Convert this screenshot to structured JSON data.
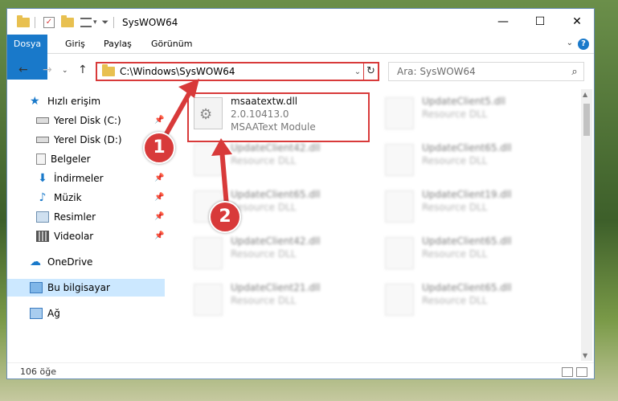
{
  "window": {
    "title": "SysWOW64",
    "controls": [
      "—",
      "☐",
      "✕"
    ]
  },
  "ribbon": {
    "tabs": [
      "Dosya",
      "Giriş",
      "Paylaş",
      "Görünüm"
    ],
    "help": "?"
  },
  "address": {
    "path": "C:\\Windows\\SysWOW64",
    "search_placeholder": "Ara: SysWOW64"
  },
  "nav": {
    "items": [
      {
        "label": "Hızlı erişim",
        "icon": "star-icon",
        "pinned": false
      },
      {
        "label": "Yerel Disk (C:)",
        "icon": "drive-icon",
        "pinned": true
      },
      {
        "label": "Yerel Disk (D:)",
        "icon": "drive-icon",
        "pinned": true
      },
      {
        "label": "Belgeler",
        "icon": "documents-icon",
        "pinned": true
      },
      {
        "label": "İndirmeler",
        "icon": "download-icon",
        "pinned": true
      },
      {
        "label": "Müzik",
        "icon": "music-icon",
        "pinned": true
      },
      {
        "label": "Resimler",
        "icon": "pictures-icon",
        "pinned": true
      },
      {
        "label": "Videolar",
        "icon": "videos-icon",
        "pinned": true
      },
      {
        "label": "OneDrive",
        "icon": "cloud-icon",
        "pinned": false
      },
      {
        "label": "Bu bilgisayar",
        "icon": "computer-icon",
        "pinned": false,
        "selected": true
      },
      {
        "label": "Ağ",
        "icon": "network-icon",
        "pinned": false
      }
    ]
  },
  "files": [
    {
      "name": "msaatextw.dll",
      "version": "2.0.10413.0",
      "desc": "MSAAText Module",
      "blurred": false
    },
    {
      "name": "UpdateClient5.dll",
      "desc": "Resource DLL",
      "blurred": true
    },
    {
      "name": "UpdateClient42.dll",
      "desc": "Resource DLL",
      "blurred": true
    },
    {
      "name": "UpdateClient65.dll",
      "desc": "Resource DLL",
      "blurred": true
    },
    {
      "name": "UpdateClient65.dll",
      "desc": "Resource DLL",
      "blurred": true
    },
    {
      "name": "UpdateClient19.dll",
      "desc": "Resource DLL",
      "blurred": true
    },
    {
      "name": "UpdateClient42.dll",
      "desc": "Resource DLL",
      "blurred": true
    },
    {
      "name": "UpdateClient65.dll",
      "desc": "Resource DLL",
      "blurred": true
    },
    {
      "name": "UpdateClient21.dll",
      "desc": "Resource DLL",
      "blurred": true
    },
    {
      "name": "UpdateClient65.dll",
      "desc": "Resource DLL",
      "blurred": true
    }
  ],
  "status": {
    "count": "106 öğe"
  },
  "annotations": {
    "step1": "1",
    "step2": "2"
  },
  "colors": {
    "accent": "#1979ca",
    "highlight": "#d83a3a",
    "selected": "#cce8ff"
  }
}
